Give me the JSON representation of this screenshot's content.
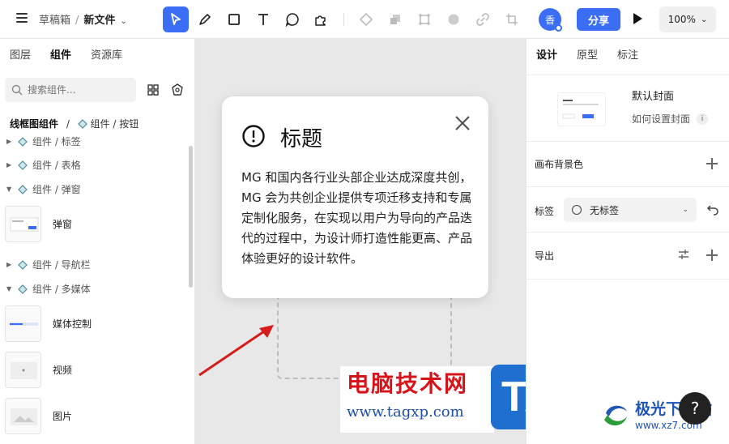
{
  "topbar": {
    "crumb_parent": "草稿箱",
    "crumb_sep": "/",
    "file_name": "新文件",
    "tools": [
      "pointer-icon",
      "pen-icon",
      "rectangle-icon",
      "text-icon",
      "chat-bubble-icon",
      "puzzle-icon",
      "component-icon",
      "duplicate-icon",
      "frame-icon",
      "circle-icon",
      "link-icon",
      "crop-icon"
    ],
    "avatar_text": "香",
    "share_label": "分享",
    "zoom": "100%"
  },
  "left_panel": {
    "tabs": [
      {
        "label": "图层"
      },
      {
        "label": "组件"
      },
      {
        "label": "资源库"
      }
    ],
    "active_tab": 1,
    "search_placeholder": "搜索组件...",
    "path_root": "线框图组件",
    "path_sep": "/",
    "path_leaf": "组件 / 按钮",
    "tree": [
      {
        "label": "组件 / 标签",
        "expanded": false
      },
      {
        "label": "组件 / 表格",
        "expanded": false
      },
      {
        "label": "组件 / 弹窗",
        "expanded": true
      },
      {
        "label": "组件 / 导航栏",
        "expanded": false
      },
      {
        "label": "组件 / 多媒体",
        "expanded": true
      }
    ],
    "components": [
      {
        "label": "弹窗"
      },
      {
        "label": "媒体控制"
      },
      {
        "label": "视频"
      },
      {
        "label": "图片"
      }
    ]
  },
  "dialog": {
    "title": "标题",
    "body": "MG 和国内各行业头部企业达成深度共创，MG 会为共创企业提供专项迁移支持和专属定制化服务，在实现以用户为导向的产品迭代的过程中，为设计师打造性能更高、产品体验更好的设计软件。"
  },
  "right_panel": {
    "tabs": [
      {
        "label": "设计"
      },
      {
        "label": "原型"
      },
      {
        "label": "标注"
      }
    ],
    "active_tab": 0,
    "cover_title": "默认封面",
    "cover_link": "如何设置封面",
    "info_symbol": "i",
    "canvas_bg_label": "画布背景色",
    "tag_label": "标签",
    "tag_value": "无标签",
    "export_label": "导出"
  },
  "overlay": {
    "watermark_title": "电脑技术网",
    "watermark_url": "www.tagxp.com",
    "tag_badge": "TAG",
    "help_symbol": "?",
    "logo2_title": "极光下载站",
    "logo2_url": "www.xz7.com"
  },
  "colors": {
    "accent": "#3b6ef5",
    "watermark_red": "#d7131a",
    "tag_blue": "#1e6fd0"
  }
}
